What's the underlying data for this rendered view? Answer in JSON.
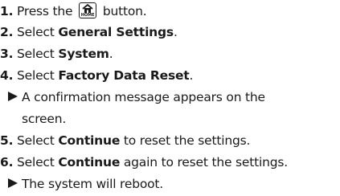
{
  "steps": [
    {
      "num": "1.",
      "pre": "Press the",
      "button_text": "HOME",
      "post": "button."
    },
    {
      "num": "2.",
      "pre": "Select",
      "bold": "General Settings",
      "post": "."
    },
    {
      "num": "3.",
      "pre": "Select",
      "bold": "System",
      "post": "."
    },
    {
      "num": "4.",
      "pre": "Select",
      "bold": "Factory Data Reset",
      "post": "."
    },
    {
      "num": "5.",
      "pre": "Select",
      "bold": "Continue",
      "post": "to reset the settings."
    },
    {
      "num": "6.",
      "pre": "Select",
      "bold": "Continue",
      "post": "again to reset the settings."
    }
  ],
  "results": [
    {
      "line1": "A confirmation message appears on the",
      "line2": "screen."
    },
    {
      "line1": "The system will reboot."
    }
  ],
  "icons": {
    "home_button": "home-icon",
    "result_marker": "triangle-right-icon"
  }
}
